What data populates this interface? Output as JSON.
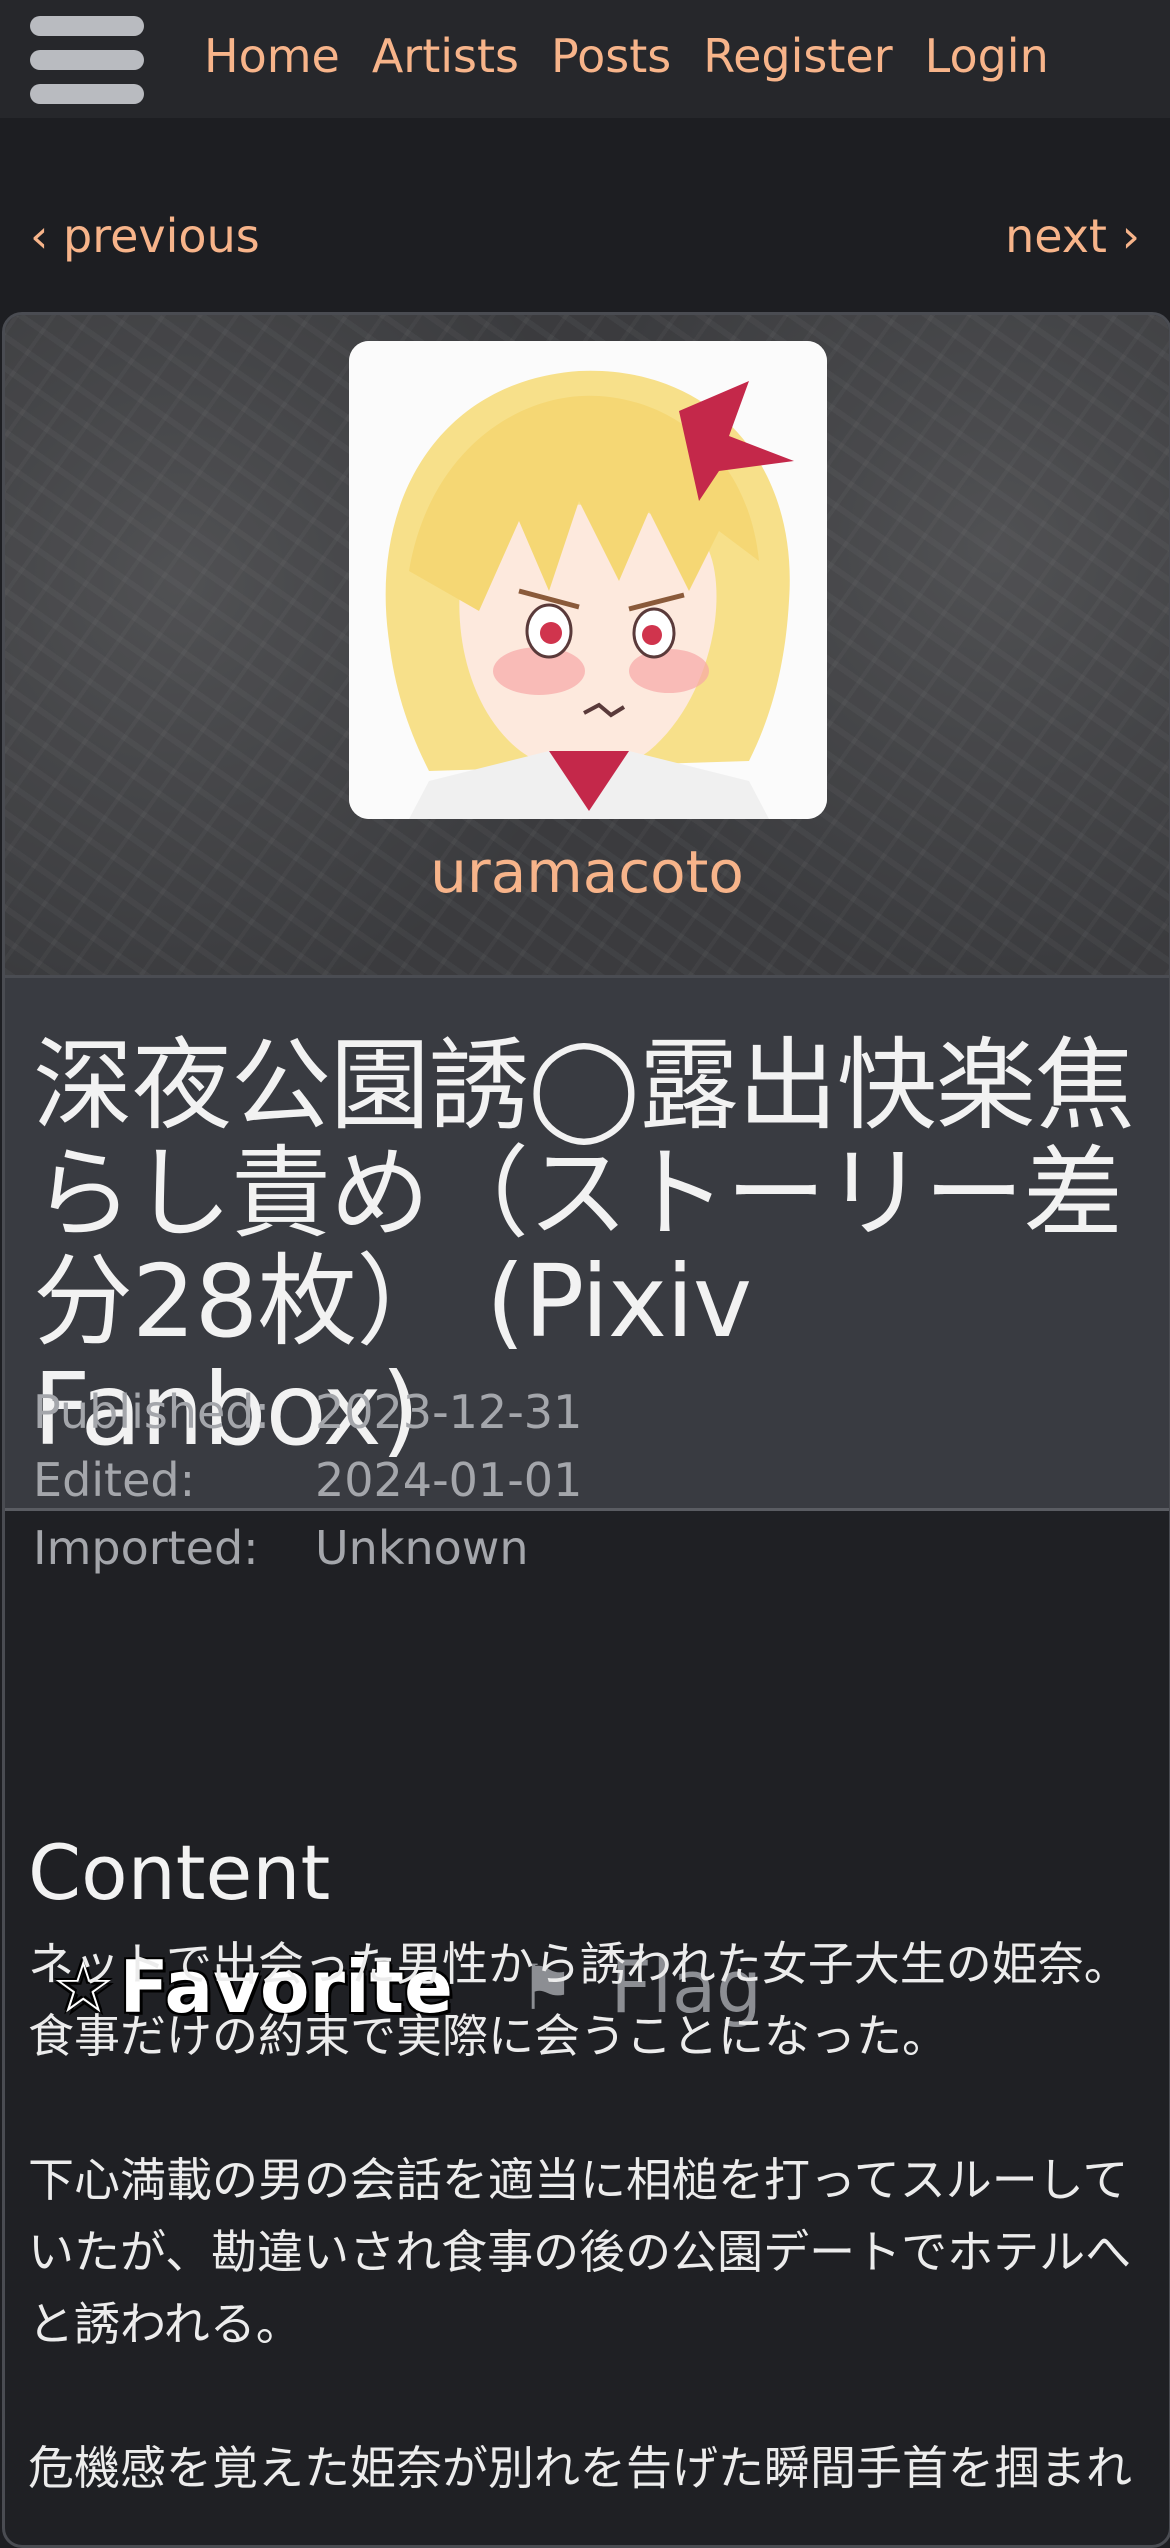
{
  "nav": {
    "menu_icon": "hamburger-menu-icon",
    "links": [
      "Home",
      "Artists",
      "Posts",
      "Register",
      "Login"
    ]
  },
  "pager": {
    "previous": "‹ previous",
    "next": "next ›"
  },
  "artist": {
    "name": "uramacoto"
  },
  "post": {
    "title": "深夜公園誘◯露出快楽焦らし責め（ストーリー差分28枚） (Pixiv Fanbox)",
    "meta": [
      {
        "key": "Published:",
        "value": "2023-12-31"
      },
      {
        "key": "Edited:",
        "value": "2024-01-01"
      },
      {
        "key": "Imported:",
        "value": "Unknown"
      }
    ],
    "favorite_label": "Favorite",
    "favorite_icon": "star-outline-icon",
    "flag_label": "Flag",
    "flag_icon": "flag-icon"
  },
  "content": {
    "heading": "Content",
    "paragraphs": [
      "ネットで出会った男性から誘われた女子大生の姫奈。",
      "食事だけの約束で実際に会うことになった。",
      "",
      "下心満載の男の会話を適当に相槌を打ってスルーしていたが、勘違いされ食事の後の公園デートでホテルへと誘われる。",
      "",
      "危機感を覚えた姫奈が別れを告げた瞬間手首を掴まれ"
    ]
  },
  "colors": {
    "accent": "#f7b48a",
    "background": "#1d1e22",
    "panel": "#393b41"
  }
}
